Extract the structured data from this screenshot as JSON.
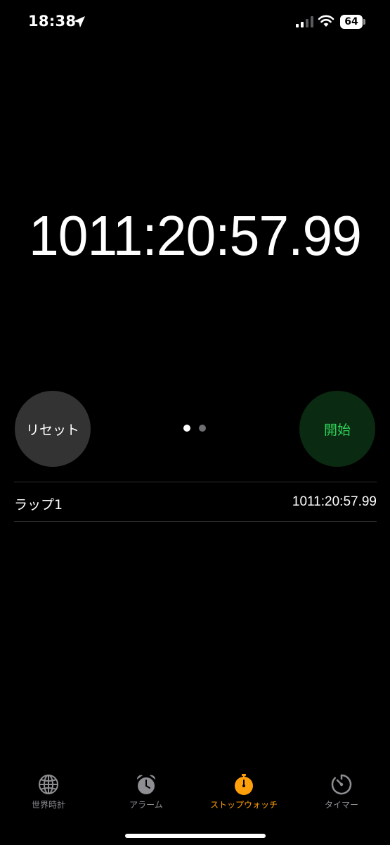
{
  "status_bar": {
    "time": "18:38",
    "battery": "64"
  },
  "stopwatch": {
    "display": "1011:20:57.99"
  },
  "controls": {
    "reset_label": "リセット",
    "start_label": "開始",
    "page_count": 2,
    "active_page": 1
  },
  "laps": [
    {
      "label": "ラップ1",
      "time": "1011:20:57.99"
    }
  ],
  "tabs": [
    {
      "label": "世界時計",
      "icon": "globe-icon",
      "active": false
    },
    {
      "label": "アラーム",
      "icon": "alarm-clock-icon",
      "active": false
    },
    {
      "label": "ストップウォッチ",
      "icon": "stopwatch-icon",
      "active": true
    },
    {
      "label": "タイマー",
      "icon": "timer-icon",
      "active": false
    }
  ],
  "colors": {
    "background": "#000000",
    "accent": "#ff9f0a",
    "start_text": "#30d158",
    "start_bg": "#0a2a12",
    "reset_bg": "#333333",
    "inactive_tab": "#8e8e93"
  }
}
